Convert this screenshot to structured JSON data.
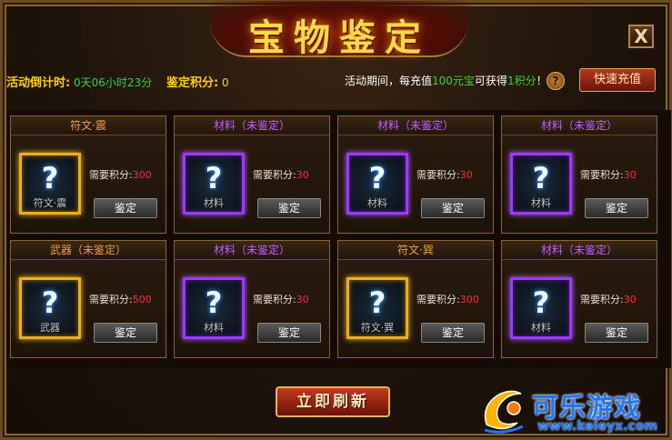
{
  "window": {
    "title": "宝物鉴定",
    "close_label": "X"
  },
  "info": {
    "countdown_label": "活动倒计时:",
    "countdown_value": "0天06小时23分",
    "points_label": "鉴定积分:",
    "points_value": "0",
    "promo_prefix": "活动期间，每充值",
    "promo_amount": "100元宝",
    "promo_middle": "可获得",
    "promo_points": "1积分",
    "promo_suffix": "！",
    "help_icon": "question-icon",
    "recharge_label": "快速充值"
  },
  "cards": [
    {
      "title": "符文·震",
      "rarity": "gold",
      "slot_label": "符文·震",
      "need_label": "需要积分:",
      "need_value": "300",
      "button": "鉴定"
    },
    {
      "title": "材料（未鉴定）",
      "rarity": "purple",
      "slot_label": "材料",
      "need_label": "需要积分:",
      "need_value": "30",
      "button": "鉴定"
    },
    {
      "title": "材料（未鉴定）",
      "rarity": "purple",
      "slot_label": "材料",
      "need_label": "需要积分:",
      "need_value": "30",
      "button": "鉴定"
    },
    {
      "title": "材料（未鉴定）",
      "rarity": "purple",
      "slot_label": "材料",
      "need_label": "需要积分:",
      "need_value": "30",
      "button": "鉴定"
    },
    {
      "title": "武器（未鉴定）",
      "rarity": "gold",
      "slot_label": "武器",
      "need_label": "需要积分:",
      "need_value": "500",
      "button": "鉴定"
    },
    {
      "title": "材料（未鉴定）",
      "rarity": "purple",
      "slot_label": "材料",
      "need_label": "需要积分:",
      "need_value": "30",
      "button": "鉴定"
    },
    {
      "title": "符文·巽",
      "rarity": "gold",
      "slot_label": "符文·巽",
      "need_label": "需要积分:",
      "need_value": "300",
      "button": "鉴定"
    },
    {
      "title": "材料（未鉴定）",
      "rarity": "purple",
      "slot_label": "材料",
      "need_label": "需要积分:",
      "need_value": "30",
      "button": "鉴定"
    }
  ],
  "refresh_label": "立即刷新",
  "watermark": {
    "name": "可乐游戏",
    "url": "www.keleyx.com"
  },
  "colors": {
    "gold": "#e8b020",
    "purple": "#9a3aff",
    "need_value": "#ff3030",
    "title": "#ffd84a"
  }
}
